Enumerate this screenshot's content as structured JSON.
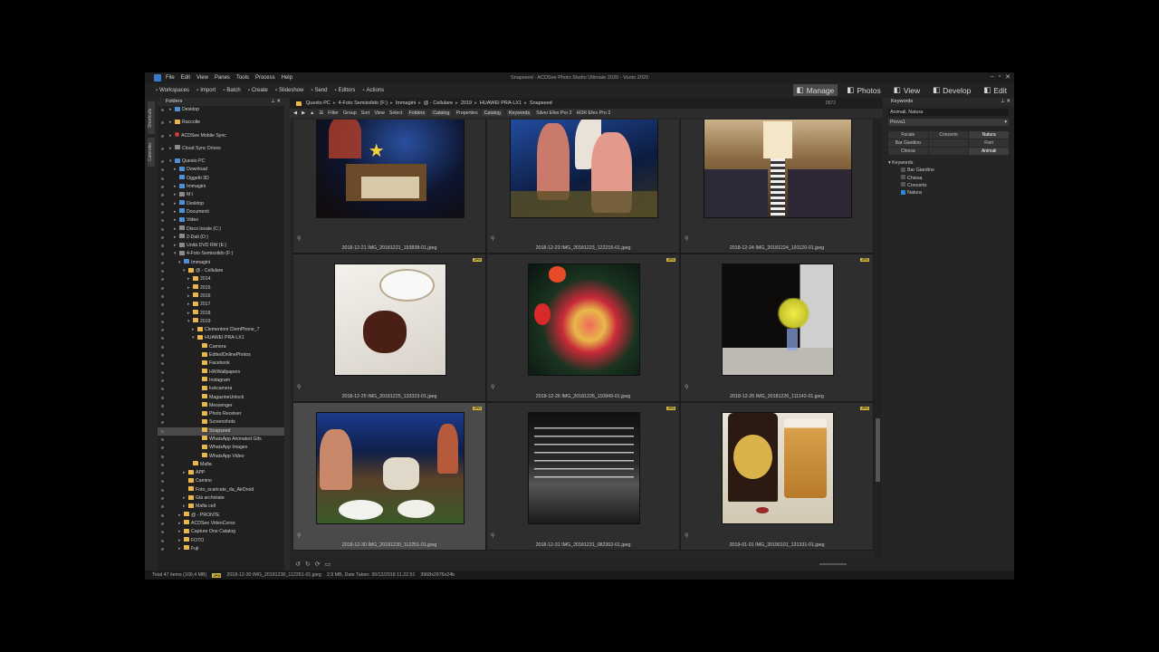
{
  "window": {
    "title": "Snapseed - ACDSee Photo Studio Ultimate 2020 - Vuoto 2020",
    "menu": [
      "File",
      "Edit",
      "View",
      "Panes",
      "Tools",
      "Process",
      "Help"
    ]
  },
  "toolbar": {
    "items": [
      "Workspaces",
      "Import",
      "Batch",
      "Create",
      "Slideshow",
      "Send",
      "Editors",
      "Actions"
    ]
  },
  "modes": [
    {
      "label": "Manage",
      "icon": "grid-icon",
      "active": true
    },
    {
      "label": "Photos",
      "icon": "photos-icon",
      "active": false
    },
    {
      "label": "View",
      "icon": "eye-icon",
      "active": false
    },
    {
      "label": "Develop",
      "icon": "develop-icon",
      "active": false
    },
    {
      "label": "Edit",
      "icon": "brush-icon",
      "active": false
    }
  ],
  "vertical_tabs": [
    "Shortcuts",
    "Calendar"
  ],
  "folders_panel": {
    "title": "Folders",
    "rows": [
      {
        "label": "Desktop",
        "indent": 1,
        "icon": "blue",
        "arrow": "▸"
      },
      {
        "label": "Raccolte",
        "indent": 1,
        "icon": "yellow",
        "arrow": "▸",
        "gap": true
      },
      {
        "label": "ACDSee Mobile Sync",
        "indent": 1,
        "icon": "red",
        "arrow": "▸",
        "gap": true
      },
      {
        "label": "Cloud Sync Drives",
        "indent": 1,
        "icon": "gray",
        "arrow": "▸",
        "gap": true
      },
      {
        "label": "Questo PC",
        "indent": 1,
        "icon": "blue",
        "arrow": "▾",
        "gap": true
      },
      {
        "label": "Download",
        "indent": 2,
        "icon": "blue",
        "arrow": "▸"
      },
      {
        "label": "Oggetti 3D",
        "indent": 2,
        "icon": "blue",
        "arrow": ""
      },
      {
        "label": "Immagini",
        "indent": 2,
        "icon": "blue",
        "arrow": "▸"
      },
      {
        "label": "M:\\",
        "indent": 2,
        "icon": "gray",
        "arrow": "▸"
      },
      {
        "label": "Desktop",
        "indent": 2,
        "icon": "blue",
        "arrow": "▸"
      },
      {
        "label": "Documenti",
        "indent": 2,
        "icon": "blue",
        "arrow": "▸"
      },
      {
        "label": "Video",
        "indent": 2,
        "icon": "blue",
        "arrow": "▸"
      },
      {
        "label": "Disco locale (C:)",
        "indent": 2,
        "icon": "gray",
        "arrow": "▸"
      },
      {
        "label": "2-Dati (D:)",
        "indent": 2,
        "icon": "gray",
        "arrow": "▸"
      },
      {
        "label": "Unità DVD RW (E:)",
        "indent": 2,
        "icon": "gray",
        "arrow": "▸"
      },
      {
        "label": "4-Foto Semisolido (F:)",
        "indent": 2,
        "icon": "gray",
        "arrow": "▾"
      },
      {
        "label": "Immagini",
        "indent": 3,
        "icon": "blue",
        "arrow": "▾"
      },
      {
        "label": "@ - Cellulare",
        "indent": 4,
        "icon": "yellow",
        "arrow": "▾"
      },
      {
        "label": "2014",
        "indent": 5,
        "icon": "yellow",
        "arrow": "▸"
      },
      {
        "label": "2015",
        "indent": 5,
        "icon": "yellow",
        "arrow": "▸"
      },
      {
        "label": "2016",
        "indent": 5,
        "icon": "yellow",
        "arrow": "▸"
      },
      {
        "label": "2017",
        "indent": 5,
        "icon": "yellow",
        "arrow": "▸"
      },
      {
        "label": "2018",
        "indent": 5,
        "icon": "yellow",
        "arrow": "▸"
      },
      {
        "label": "2019",
        "indent": 5,
        "icon": "yellow",
        "arrow": "▾"
      },
      {
        "label": "Clementoni ClemPhone_7",
        "indent": 6,
        "icon": "yellow",
        "arrow": "▸"
      },
      {
        "label": "HUAWEI PRA-LX1",
        "indent": 6,
        "icon": "yellow",
        "arrow": "▾"
      },
      {
        "label": "Camera",
        "indent": 7,
        "icon": "yellow",
        "arrow": ""
      },
      {
        "label": "EditedOnlinePhotos",
        "indent": 7,
        "icon": "yellow",
        "arrow": ""
      },
      {
        "label": "Facebook",
        "indent": 7,
        "icon": "yellow",
        "arrow": ""
      },
      {
        "label": "HWWallpapers",
        "indent": 7,
        "icon": "yellow",
        "arrow": ""
      },
      {
        "label": "Instagram",
        "indent": 7,
        "icon": "yellow",
        "arrow": ""
      },
      {
        "label": "kukcamera",
        "indent": 7,
        "icon": "yellow",
        "arrow": ""
      },
      {
        "label": "MagazineUnlock",
        "indent": 7,
        "icon": "yellow",
        "arrow": ""
      },
      {
        "label": "Messenger",
        "indent": 7,
        "icon": "yellow",
        "arrow": ""
      },
      {
        "label": "Photo Receiver",
        "indent": 7,
        "icon": "yellow",
        "arrow": ""
      },
      {
        "label": "Screenshots",
        "indent": 7,
        "icon": "yellow",
        "arrow": ""
      },
      {
        "label": "Snapseed",
        "indent": 7,
        "icon": "yellow",
        "arrow": "",
        "selected": true
      },
      {
        "label": "WhatsApp Animated Gifs",
        "indent": 7,
        "icon": "yellow",
        "arrow": ""
      },
      {
        "label": "WhatsApp Images",
        "indent": 7,
        "icon": "yellow",
        "arrow": ""
      },
      {
        "label": "WhatsApp Video",
        "indent": 7,
        "icon": "yellow",
        "arrow": ""
      },
      {
        "label": "Mafia",
        "indent": 5,
        "icon": "yellow",
        "arrow": ""
      },
      {
        "label": "APP",
        "indent": 4,
        "icon": "yellow",
        "arrow": "▸"
      },
      {
        "label": "Camino",
        "indent": 4,
        "icon": "yellow",
        "arrow": ""
      },
      {
        "label": "Foto_scaricate_da_AirDroid",
        "indent": 4,
        "icon": "yellow",
        "arrow": ""
      },
      {
        "label": "Già archiviate",
        "indent": 4,
        "icon": "yellow",
        "arrow": "▸"
      },
      {
        "label": "Mafia cell",
        "indent": 4,
        "icon": "yellow",
        "arrow": "▸"
      },
      {
        "label": "@ - PRONTE",
        "indent": 3,
        "icon": "yellow",
        "arrow": "▸"
      },
      {
        "label": "ACDSee VideoCorso",
        "indent": 3,
        "icon": "yellow",
        "arrow": "▸"
      },
      {
        "label": "Capture One Catalog",
        "indent": 3,
        "icon": "yellow",
        "arrow": "▸"
      },
      {
        "label": "FOTO",
        "indent": 3,
        "icon": "yellow",
        "arrow": "▸"
      },
      {
        "label": "Fuji",
        "indent": 3,
        "icon": "yellow",
        "arrow": "▸"
      }
    ]
  },
  "path": [
    "Questo PC",
    "4-Foto Semisolido (F:)",
    "Immagini",
    "@ - Cellulare",
    "2019",
    "HUAWEI PRA-LX1",
    "Snapseed"
  ],
  "counter": "0572",
  "filterbar": [
    "Filter",
    "Group",
    "Sort",
    "View",
    "Select",
    "Folders",
    "Catalog",
    "Properties",
    "Catalog",
    "Keywords",
    "Silver Efex Pro 2",
    "HDR Efex Pro 2"
  ],
  "photos": [
    {
      "caption": "2018-12-21 IMG_20181221_193838-01.jpeg",
      "badge": "",
      "selected": false
    },
    {
      "caption": "2018-12-23 IMG_20181223_122215-01.jpeg",
      "badge": "",
      "selected": false
    },
    {
      "caption": "2018-12-24 IMG_20181224_191120-01.jpeg",
      "badge": "",
      "selected": false
    },
    {
      "caption": "2018-12-25 IMG_20181225_133323-01.jpeg",
      "badge": "JPG",
      "selected": false
    },
    {
      "caption": "2018-12-26 IMG_20181226_110849-01.jpeg",
      "badge": "JPG",
      "selected": false
    },
    {
      "caption": "2018-12-26 IMG_20181226_111142-01.jpeg",
      "badge": "JPG",
      "selected": false
    },
    {
      "caption": "2018-12-30 IMG_20181230_112251-01.jpeg",
      "badge": "JPG",
      "selected": true
    },
    {
      "caption": "2018-12-31 IMG_20181231_082302-01.jpeg",
      "badge": "JPG",
      "selected": false
    },
    {
      "caption": "2019-01-01 IMG_20190101_131331-01.jpeg",
      "badge": "JPG",
      "selected": false
    }
  ],
  "keywords_panel": {
    "title": "Keywords",
    "input_value": "Animali, Natura",
    "set_value": "Prova1",
    "quick": [
      {
        "label": "Focale",
        "on": false
      },
      {
        "label": "Concerto",
        "on": false
      },
      {
        "label": "Natura",
        "on": true
      },
      {
        "label": "Bar Giardino",
        "on": false
      },
      {
        "label": "",
        "on": false
      },
      {
        "label": "Fiori",
        "on": false
      },
      {
        "label": "Chiesa",
        "on": false
      },
      {
        "label": "",
        "on": false
      },
      {
        "label": "Animali",
        "on": true
      }
    ],
    "tree_title": "Keywords",
    "tree": [
      {
        "label": "Bar Giardino",
        "checked": false
      },
      {
        "label": "Chiesa",
        "checked": false
      },
      {
        "label": "Concerto",
        "checked": false
      },
      {
        "label": "Natura",
        "checked": true
      }
    ]
  },
  "status": {
    "total": "Total 47 items  (100,4 MB)",
    "badge": "JPG",
    "file": "2018-12-30 IMG_20181230_112251-01.jpeg",
    "info": "2,9 MB, Date Taken: 30/12/2018 11.22.51",
    "dims": "3968x2976x24b"
  },
  "colors": {
    "accent": "#2f86d8",
    "badge": "#d3b93c",
    "bg": "#2b2b2b"
  }
}
